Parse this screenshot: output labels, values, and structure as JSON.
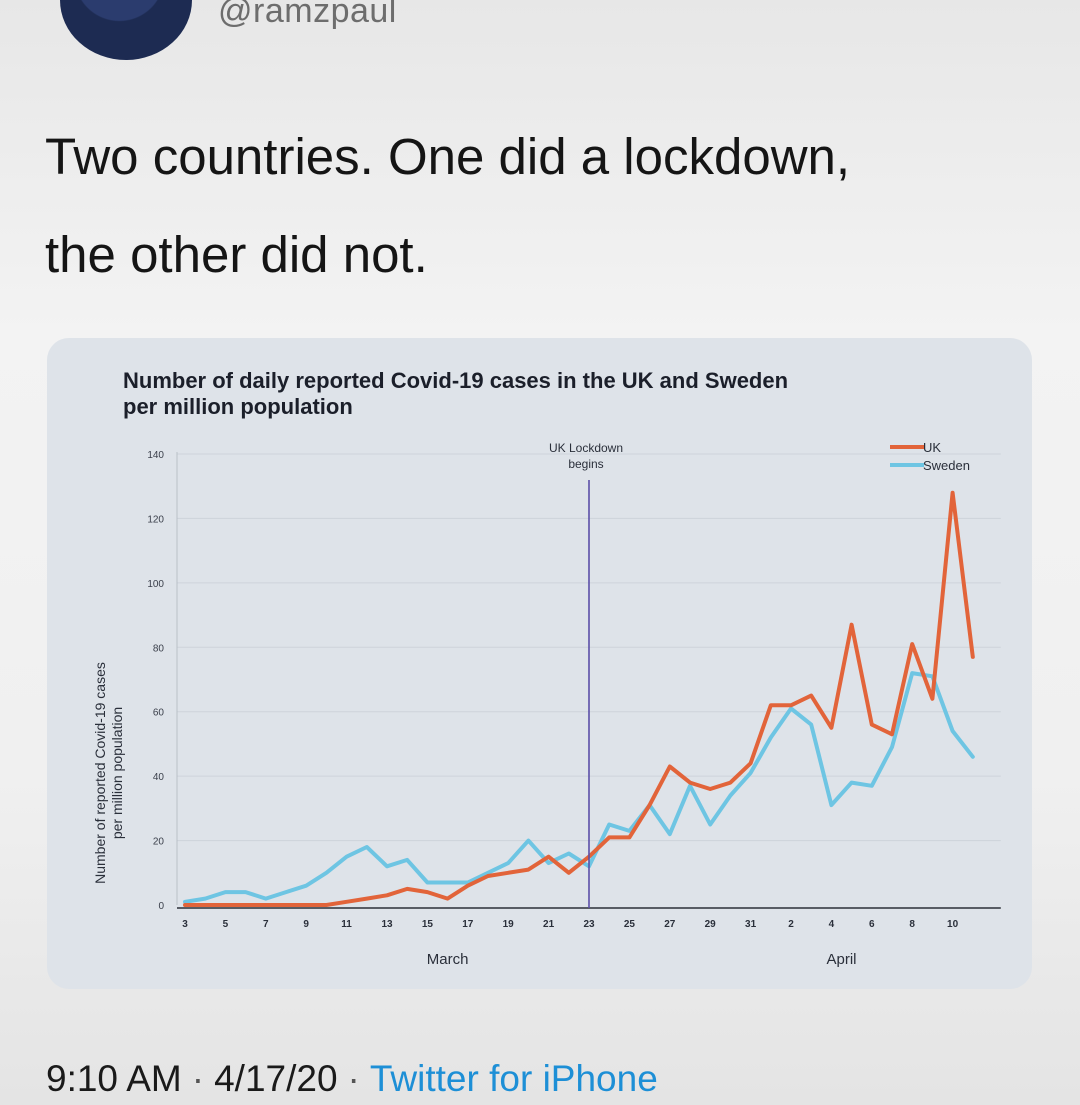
{
  "tweet": {
    "handle": "@ramzpaul",
    "text_line1": "Two countries. One did a lockdown,",
    "text_line2": "the other did not.",
    "time": "9:10 AM",
    "separator": "·",
    "date": "4/17/20",
    "source": "Twitter for iPhone"
  },
  "chart_data": {
    "type": "line",
    "title_line1": "Number of daily reported Covid-19 cases in the UK and Sweden",
    "title_line2": "per million population",
    "ylabel_line1": "Number of reported Covid-19 cases",
    "ylabel_line2": "per million population",
    "ylim": [
      0,
      140
    ],
    "yticks": [
      0,
      20,
      40,
      60,
      80,
      100,
      120,
      140
    ],
    "x": [
      "Mar 3",
      "Mar 4",
      "Mar 5",
      "Mar 6",
      "Mar 7",
      "Mar 8",
      "Mar 9",
      "Mar 10",
      "Mar 11",
      "Mar 12",
      "Mar 13",
      "Mar 14",
      "Mar 15",
      "Mar 16",
      "Mar 17",
      "Mar 18",
      "Mar 19",
      "Mar 20",
      "Mar 21",
      "Mar 22",
      "Mar 23",
      "Mar 24",
      "Mar 25",
      "Mar 26",
      "Mar 27",
      "Mar 28",
      "Mar 29",
      "Mar 30",
      "Mar 31",
      "Apr 1",
      "Apr 2",
      "Apr 3",
      "Apr 4",
      "Apr 5",
      "Apr 6",
      "Apr 7",
      "Apr 8",
      "Apr 9",
      "Apr 10",
      "Apr 11"
    ],
    "xtick_labels": [
      "3",
      "5",
      "7",
      "9",
      "11",
      "13",
      "15",
      "17",
      "19",
      "21",
      "23",
      "25",
      "27",
      "29",
      "31",
      "2",
      "4",
      "6",
      "8",
      "10"
    ],
    "xtick_index": [
      0,
      2,
      4,
      6,
      8,
      10,
      12,
      14,
      16,
      18,
      20,
      22,
      24,
      26,
      28,
      30,
      32,
      34,
      36,
      38
    ],
    "month_labels": [
      {
        "label": "March",
        "at_index": 13
      },
      {
        "label": "April",
        "at_index": 32.5
      }
    ],
    "annotation": {
      "line1": "UK Lockdown",
      "line2": "begins",
      "x": "Mar 23",
      "x_index": 20,
      "color": "#5b4fa8"
    },
    "legend_position": "top-right",
    "grid": true,
    "series": [
      {
        "name": "UK",
        "color": "#e2643a",
        "values": [
          0,
          0,
          0,
          0,
          0,
          0,
          0,
          0,
          1,
          2,
          3,
          5,
          4,
          2,
          6,
          9,
          10,
          11,
          15,
          10,
          15,
          21,
          21,
          31,
          43,
          38,
          36,
          38,
          44,
          62,
          62,
          65,
          55,
          87,
          56,
          53,
          81,
          64,
          128,
          77
        ]
      },
      {
        "name": "Sweden",
        "color": "#6ec5e3",
        "values": [
          1,
          2,
          4,
          4,
          2,
          4,
          6,
          10,
          15,
          18,
          12,
          14,
          7,
          7,
          7,
          10,
          13,
          20,
          13,
          16,
          12,
          25,
          23,
          31,
          22,
          37,
          25,
          34,
          41,
          52,
          61,
          56,
          31,
          38,
          37,
          49,
          72,
          71,
          54,
          46
        ]
      }
    ]
  }
}
